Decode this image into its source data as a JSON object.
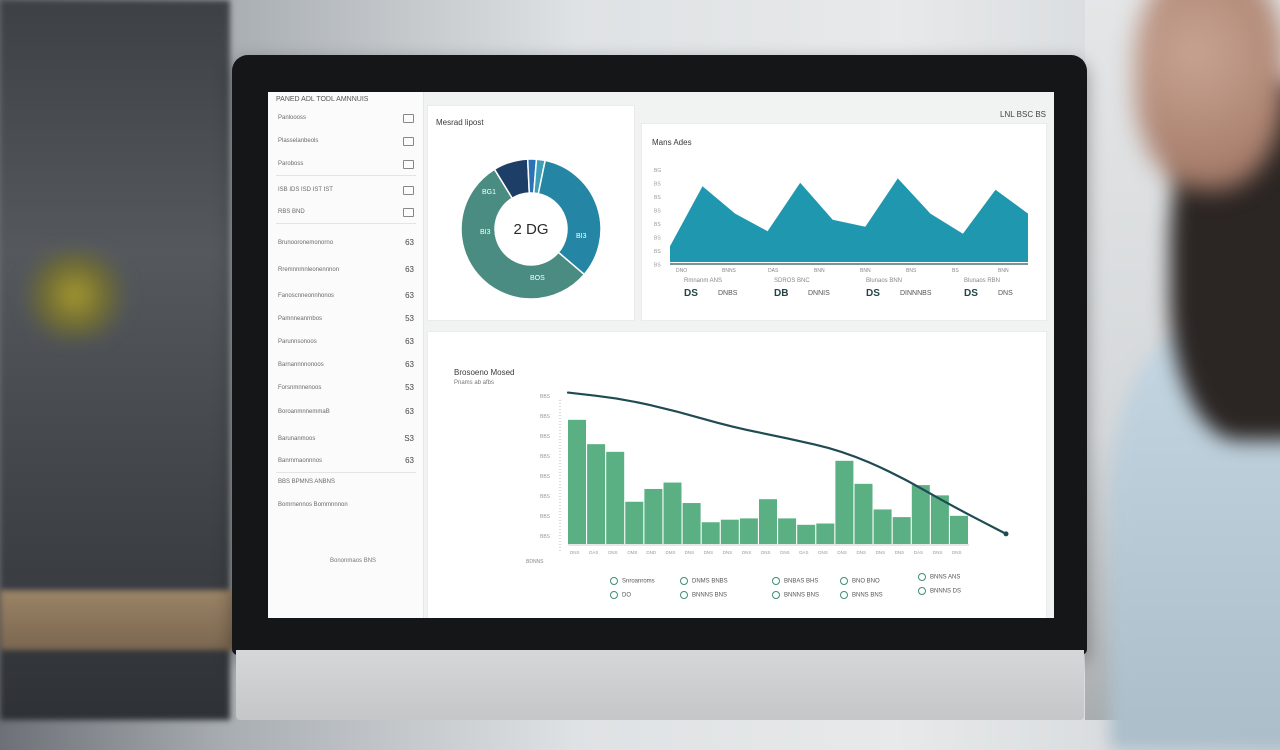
{
  "sidebar": {
    "title": "PANED ADL TODL AMNNUIS",
    "items": [
      {
        "label": "Panloooss",
        "icon": "box-icon"
      },
      {
        "label": "Plasselanbeols",
        "icon": "box-icon"
      },
      {
        "label": "Paroboss",
        "icon": "box-icon"
      },
      {
        "label": "ISB  IDS  ISD  IST  IST",
        "icon": "box-icon"
      },
      {
        "label": "RBS  BND",
        "icon": "box-icon"
      },
      {
        "label": "Brunooronemonorno",
        "value": "63"
      },
      {
        "label": "Rremnnmnleonennnon",
        "value": "63"
      },
      {
        "label": "Fanoscnneonnhonos",
        "value": "63"
      },
      {
        "label": "Pamnneanrnbos",
        "value": "53"
      },
      {
        "label": "Parunnsonoos",
        "value": "63"
      },
      {
        "label": "Barnannnnonoos",
        "value": "63"
      },
      {
        "label": "Forsnmnnenoos",
        "value": "53"
      },
      {
        "label": "BoroanmnnemmaB",
        "value": "63"
      },
      {
        "label": "Barunanmoos",
        "value": "S3"
      },
      {
        "label": "Banrnmaonnnos",
        "value": "63"
      },
      {
        "label": "BBS  BPMNS  ANBNS",
        "value": ""
      },
      {
        "label": "Bomrnennos  Bommnnnon",
        "value": ""
      }
    ],
    "footer": "Bononmaos  BNS"
  },
  "donut_card": {
    "title": "Mesrad lipost",
    "center_value": "2 DG",
    "segment_labels": [
      "BG1",
      "BI3",
      "BI3",
      "BOS"
    ],
    "segments": [
      0.08,
      0.02,
      0.02,
      0.33,
      0.55
    ],
    "colors": {
      "navy": "#1d3e66",
      "teal": "#2486a4",
      "sea": "#4a8c82",
      "light": "#3d9fb8",
      "blue": "#2a73b6"
    }
  },
  "area_card": {
    "title": "Mans Ades",
    "header_right": "LNL  BSC  BS",
    "area_color": "#1f97ae",
    "profile": [
      0.18,
      0.86,
      0.55,
      0.35,
      0.9,
      0.48,
      0.4,
      0.95,
      0.55,
      0.32,
      0.82,
      0.55
    ],
    "x_labels": [
      "DNO",
      "BNNS",
      "DAS",
      "BNN",
      "BNN",
      "BNS",
      "BS",
      "BNN"
    ],
    "y_labels": [
      "BG",
      "BS",
      "BS",
      "BS",
      "BS",
      "BS",
      "BS",
      "BS"
    ],
    "stats": [
      {
        "top": "Rmnanm  ANS",
        "num": "DS",
        "sub": "DNBS"
      },
      {
        "top": "SDROS  BNC",
        "num": "DB",
        "sub": "DNNIS"
      },
      {
        "top": "Blunaos  BNN",
        "num": "DS",
        "sub": "DINNNBS"
      },
      {
        "top": "Blunaos  RBN",
        "num": "DS",
        "sub": "DNS"
      }
    ]
  },
  "bar_card": {
    "title": "Brosoeno  Mosed",
    "subtitle": "Pnams  ab  afbs",
    "bar_color": "#5bb083",
    "line_color": "#1f4b53",
    "bars": [
      0.97,
      0.78,
      0.72,
      0.33,
      0.43,
      0.48,
      0.32,
      0.17,
      0.19,
      0.2,
      0.35,
      0.2,
      0.15,
      0.16,
      0.65,
      0.47,
      0.27,
      0.21,
      0.46,
      0.38,
      0.22
    ],
    "trend": [
      0.92,
      0.88,
      0.8,
      0.7,
      0.63,
      0.55,
      0.4,
      0.2,
      0.02
    ],
    "x_labels": [
      "DNS",
      "DAS",
      "DNS",
      "OMS",
      "DND",
      "DMS",
      "DNS",
      "DNS",
      "DNS",
      "DNS",
      "DNS",
      "DNS",
      "DAS",
      "DNS",
      "DNS",
      "DNS",
      "DNS",
      "DNS",
      "DAS",
      "DNS",
      "DNS"
    ],
    "y_labels": [
      "BBS",
      "BBS",
      "BBS",
      "BBS",
      "BBS",
      "BBS",
      "BBS",
      "BBS"
    ],
    "bottom_label": "BDNNS",
    "legend": [
      {
        "label": "Snroanroms"
      },
      {
        "label": "DNMS  BNBS"
      },
      {
        "label": "BNBAS  BHS"
      },
      {
        "label": "BNO  BNO"
      },
      {
        "label": "BNNS  ANS"
      },
      {
        "label": "DO"
      },
      {
        "label": "BNNNS  BNS"
      },
      {
        "label": "BNNNS  BNS"
      },
      {
        "label": "BNNS  BNS"
      },
      {
        "label": "BNNNS  DS"
      }
    ]
  }
}
